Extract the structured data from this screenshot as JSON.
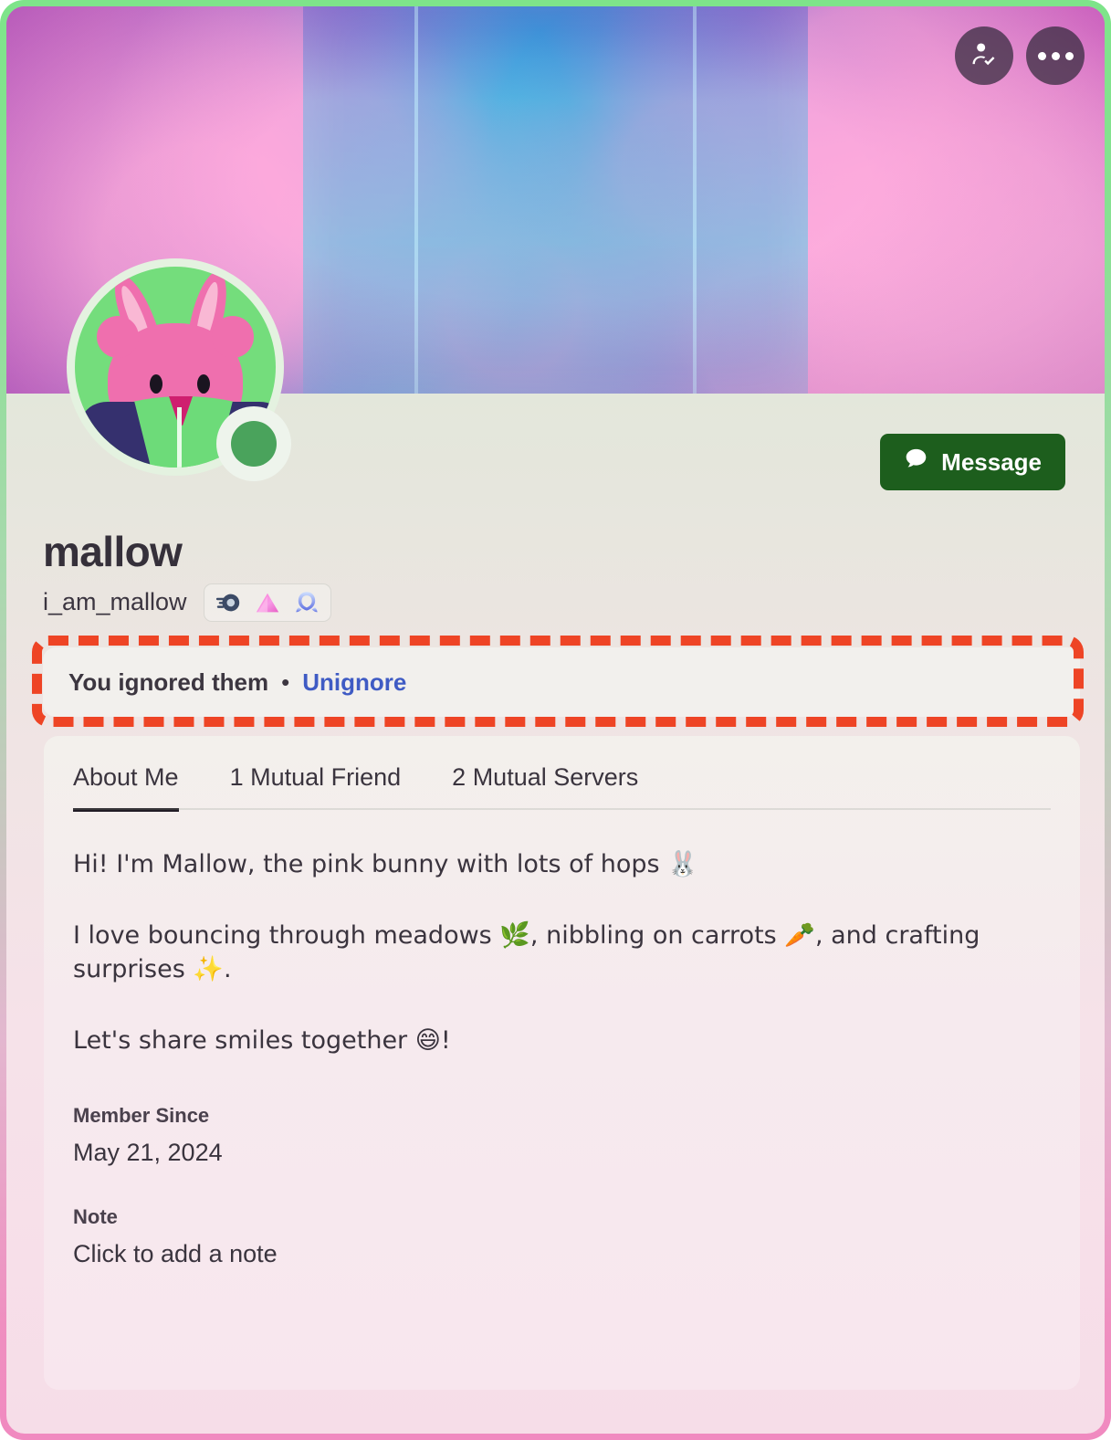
{
  "header": {
    "friend_button_label": "Friend added",
    "friend_icon": "person-check-icon",
    "more_button_label": "More options",
    "more_icon": "more-options-icon",
    "banner_description": "Cherry blossoms in front of an illuminated cyan tower at night"
  },
  "avatar": {
    "description": "Pink bunny character on green background",
    "status": "online",
    "status_color": "#4aa35c",
    "ring_color": "#e4f2e0"
  },
  "actions": {
    "message_label": "Message",
    "message_icon": "speech-bubble-icon",
    "message_bg": "#1d5e1d"
  },
  "identity": {
    "display_name": "mallow",
    "username": "i_am_mallow",
    "badges": [
      {
        "name": "discord-nitro-badge",
        "title": "Nitro"
      },
      {
        "name": "hypesquad-brilliance-badge",
        "title": "HypeSquad Brilliance"
      },
      {
        "name": "early-supporter-badge",
        "title": "Early Supporter"
      }
    ]
  },
  "ignored_banner": {
    "text": "You ignored them",
    "separator": "•",
    "action_label": "Unignore",
    "link_color": "#3f5bc4",
    "highlight_color": "#ee4425"
  },
  "tabs": [
    {
      "label": "About Me",
      "active": true
    },
    {
      "label": "1 Mutual Friend",
      "active": false
    },
    {
      "label": "2 Mutual Servers",
      "active": false
    }
  ],
  "about": {
    "bio_lines": [
      "Hi! I'm Mallow, the pink bunny with lots of hops 🐰",
      "I love bouncing through meadows 🌿, nibbling on carrots 🥕, and crafting surprises ✨.",
      "Let's share smiles together 😄!"
    ],
    "member_since_label": "Member Since",
    "member_since_value": "May 21, 2024",
    "note_label": "Note",
    "note_placeholder": "Click to add a note"
  }
}
